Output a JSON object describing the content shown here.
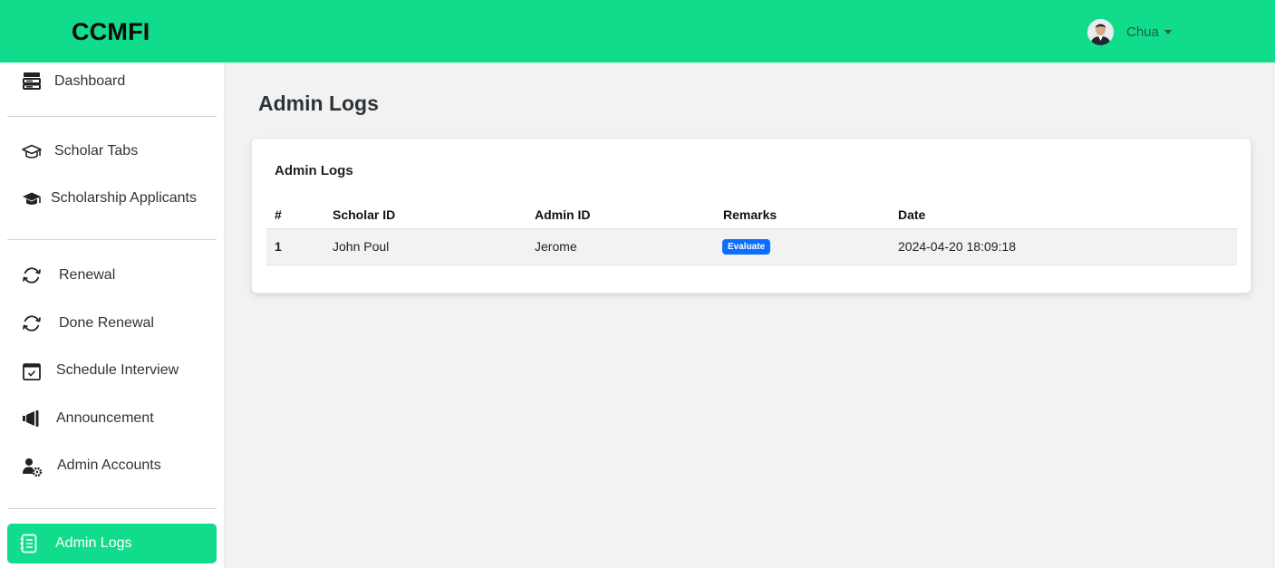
{
  "brand": "CCMFI",
  "user": {
    "name": "Chua"
  },
  "sidebar": {
    "items": [
      {
        "label": "Dashboard",
        "icon": "dashboard-icon"
      },
      {
        "label": "Scholar Tabs",
        "icon": "graduation-cap-outline-icon"
      },
      {
        "label": "Scholarship Applicants",
        "icon": "graduation-cap-icon"
      },
      {
        "label": "Renewal",
        "icon": "refresh-icon"
      },
      {
        "label": "Done Renewal",
        "icon": "refresh-icon"
      },
      {
        "label": "Schedule Interview",
        "icon": "calendar-check-icon"
      },
      {
        "label": "Announcement",
        "icon": "megaphone-icon"
      },
      {
        "label": "Admin Accounts",
        "icon": "user-gear-icon"
      },
      {
        "label": "Admin Logs",
        "icon": "list-icon",
        "active": true
      }
    ]
  },
  "page": {
    "title": "Admin Logs"
  },
  "logs": {
    "card_title": "Admin Logs",
    "columns": [
      "#",
      "Scholar ID",
      "Admin ID",
      "Remarks",
      "Date"
    ],
    "rows": [
      {
        "num": "1",
        "scholar_id": "John Poul",
        "admin_id": "Jerome",
        "remarks": "Evaluate",
        "date": "2024-04-20 18:09:18"
      }
    ]
  },
  "colors": {
    "primary": "#10dc8c",
    "badge": "#0d6efd",
    "background": "#f2f2f2"
  }
}
